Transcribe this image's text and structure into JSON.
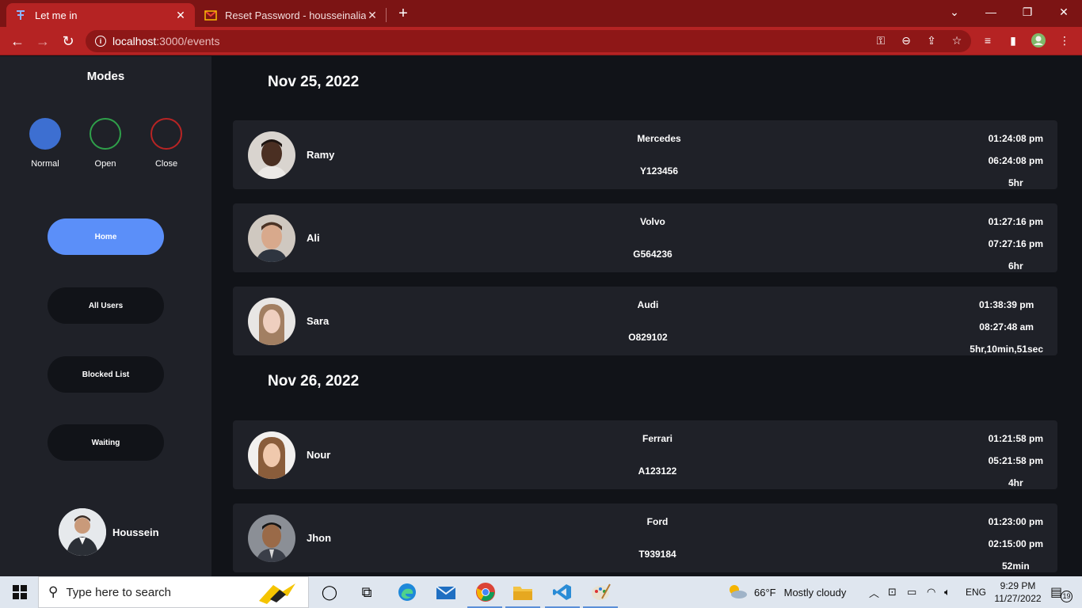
{
  "browser": {
    "tabs": [
      {
        "title": "Let me in",
        "active": true
      },
      {
        "title": "Reset Password - housseinalialdr",
        "active": false
      }
    ],
    "url_host": "localhost",
    "url_path": ":3000/events",
    "accent": "#b52323"
  },
  "sidebar": {
    "modes_title": "Modes",
    "modes": [
      {
        "label": "Normal",
        "color": "#3d6fd1",
        "filled": true
      },
      {
        "label": "Open",
        "color": "#2fa04a",
        "filled": false
      },
      {
        "label": "Close",
        "color": "#b82424",
        "filled": false
      }
    ],
    "nav": [
      {
        "label": "Home",
        "active": true
      },
      {
        "label": "All Users",
        "active": false
      },
      {
        "label": "Blocked List",
        "active": false
      },
      {
        "label": "Waiting",
        "active": false
      }
    ],
    "profile_name": "Houssein"
  },
  "events": [
    {
      "date": "Nov 25, 2022",
      "items": [
        {
          "name": "Ramy",
          "car": "Mercedes",
          "plate": "Y123456",
          "time_in": "01:24:08 pm",
          "time_out": "06:24:08 pm",
          "duration": "5hr"
        },
        {
          "name": "Ali",
          "car": "Volvo",
          "plate": "G564236",
          "time_in": "01:27:16 pm",
          "time_out": "07:27:16 pm",
          "duration": "6hr"
        },
        {
          "name": "Sara",
          "car": "Audi",
          "plate": "O829102",
          "time_in": "01:38:39 pm",
          "time_out": "08:27:48 am",
          "duration": "5hr,10min,51sec"
        }
      ]
    },
    {
      "date": "Nov 26, 2022",
      "items": [
        {
          "name": "Nour",
          "car": "Ferrari",
          "plate": "A123122",
          "time_in": "01:21:58 pm",
          "time_out": "05:21:58 pm",
          "duration": "4hr"
        },
        {
          "name": "Jhon",
          "car": "Ford",
          "plate": "T939184",
          "time_in": "01:23:00 pm",
          "time_out": "02:15:00 pm",
          "duration": "52min"
        }
      ]
    }
  ],
  "taskbar": {
    "search_placeholder": "Type here to search",
    "weather_temp": "66°F",
    "weather_text": "Mostly cloudy",
    "lang": "ENG",
    "time": "9:29 PM",
    "date": "11/27/2022",
    "notification_count": "19"
  }
}
